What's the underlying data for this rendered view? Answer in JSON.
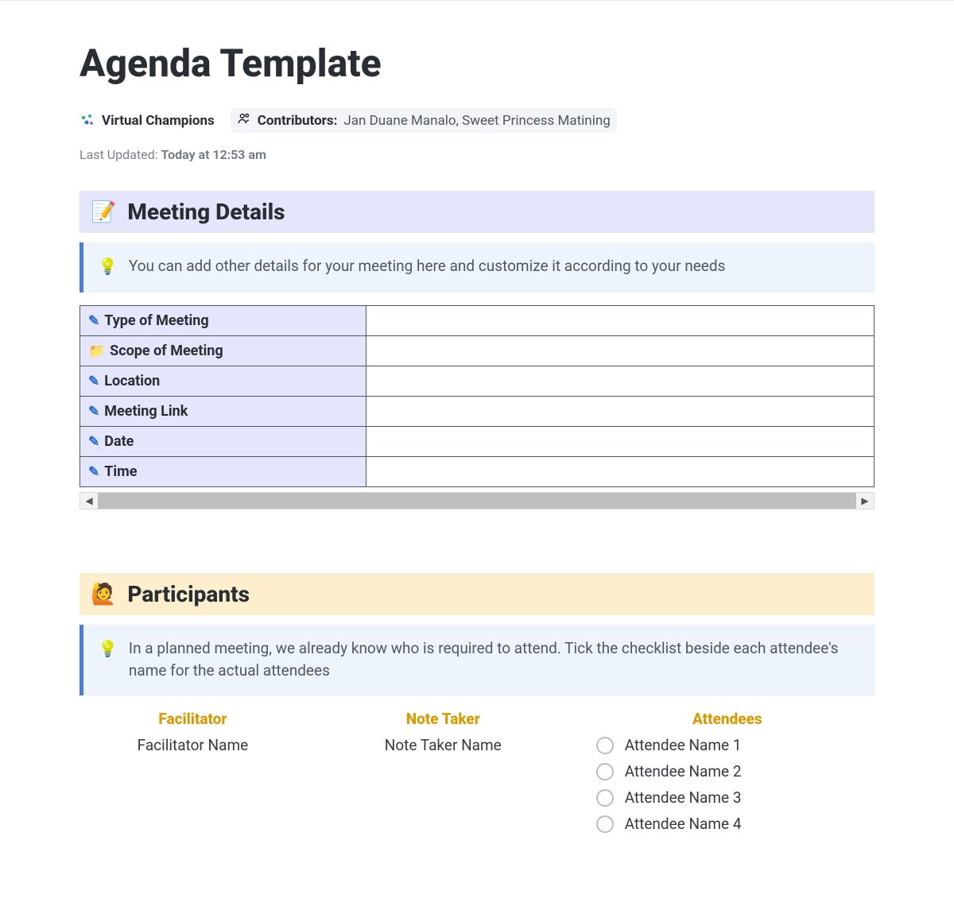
{
  "header": {
    "title": "Agenda Template",
    "workspace": "Virtual Champions",
    "contributors_label": "Contributors:",
    "contributors": "Jan Duane Manalo, Sweet Princess Matining",
    "last_updated_label": "Last Updated:",
    "last_updated_value": "Today at 12:53 am"
  },
  "meeting_details": {
    "heading": "Meeting Details",
    "hint": "You can add other details for your meeting here and customize it according to your needs",
    "rows": [
      {
        "icon": "pencil",
        "label": "Type of Meeting",
        "value": ""
      },
      {
        "icon": "folder",
        "label": "Scope of Meeting",
        "value": ""
      },
      {
        "icon": "pencil",
        "label": "Location",
        "value": ""
      },
      {
        "icon": "pencil",
        "label": "Meeting Link",
        "value": ""
      },
      {
        "icon": "pencil",
        "label": "Date",
        "value": ""
      },
      {
        "icon": "pencil",
        "label": "Time",
        "value": ""
      }
    ]
  },
  "participants": {
    "heading": "Participants",
    "hint": "In a planned meeting, we already know who is required to attend. Tick the checklist beside each attendee's name for the actual attendees",
    "facilitator_label": "Facilitator",
    "facilitator_name": "Facilitator Name",
    "note_taker_label": "Note Taker",
    "note_taker_name": "Note Taker Name",
    "attendees_label": "Attendees",
    "attendees": [
      {
        "name": "Attendee Name 1",
        "checked": false
      },
      {
        "name": "Attendee Name 2",
        "checked": false
      },
      {
        "name": "Attendee Name 3",
        "checked": false
      },
      {
        "name": "Attendee Name 4",
        "checked": false
      }
    ]
  },
  "icons": {
    "memo": "📝",
    "bulb": "💡",
    "raise_hand": "🙋",
    "folder": "📁",
    "pencil": "✏️"
  }
}
